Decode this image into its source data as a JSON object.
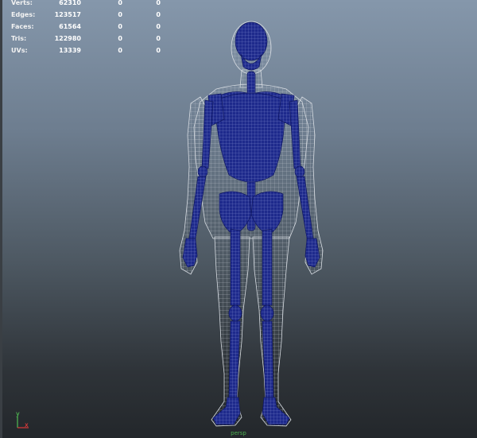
{
  "heads_up_display": {
    "rows": [
      {
        "label": "Verts:",
        "values": [
          "62310",
          "0",
          "0"
        ]
      },
      {
        "label": "Edges:",
        "values": [
          "123517",
          "0",
          "0"
        ]
      },
      {
        "label": "Faces:",
        "values": [
          "61564",
          "0",
          "0"
        ]
      },
      {
        "label": "Tris:",
        "values": [
          "122980",
          "0",
          "0"
        ]
      },
      {
        "label": "UVs:",
        "values": [
          "13339",
          "0",
          "0"
        ]
      }
    ]
  },
  "axis": {
    "x_label": "x",
    "y_label": "y"
  },
  "camera_label": "persp",
  "colors": {
    "bones": "#1e2a8c",
    "wireframe": "#c9cfd6",
    "axis_x": "#ff3b3b",
    "axis_y": "#58d85a"
  }
}
